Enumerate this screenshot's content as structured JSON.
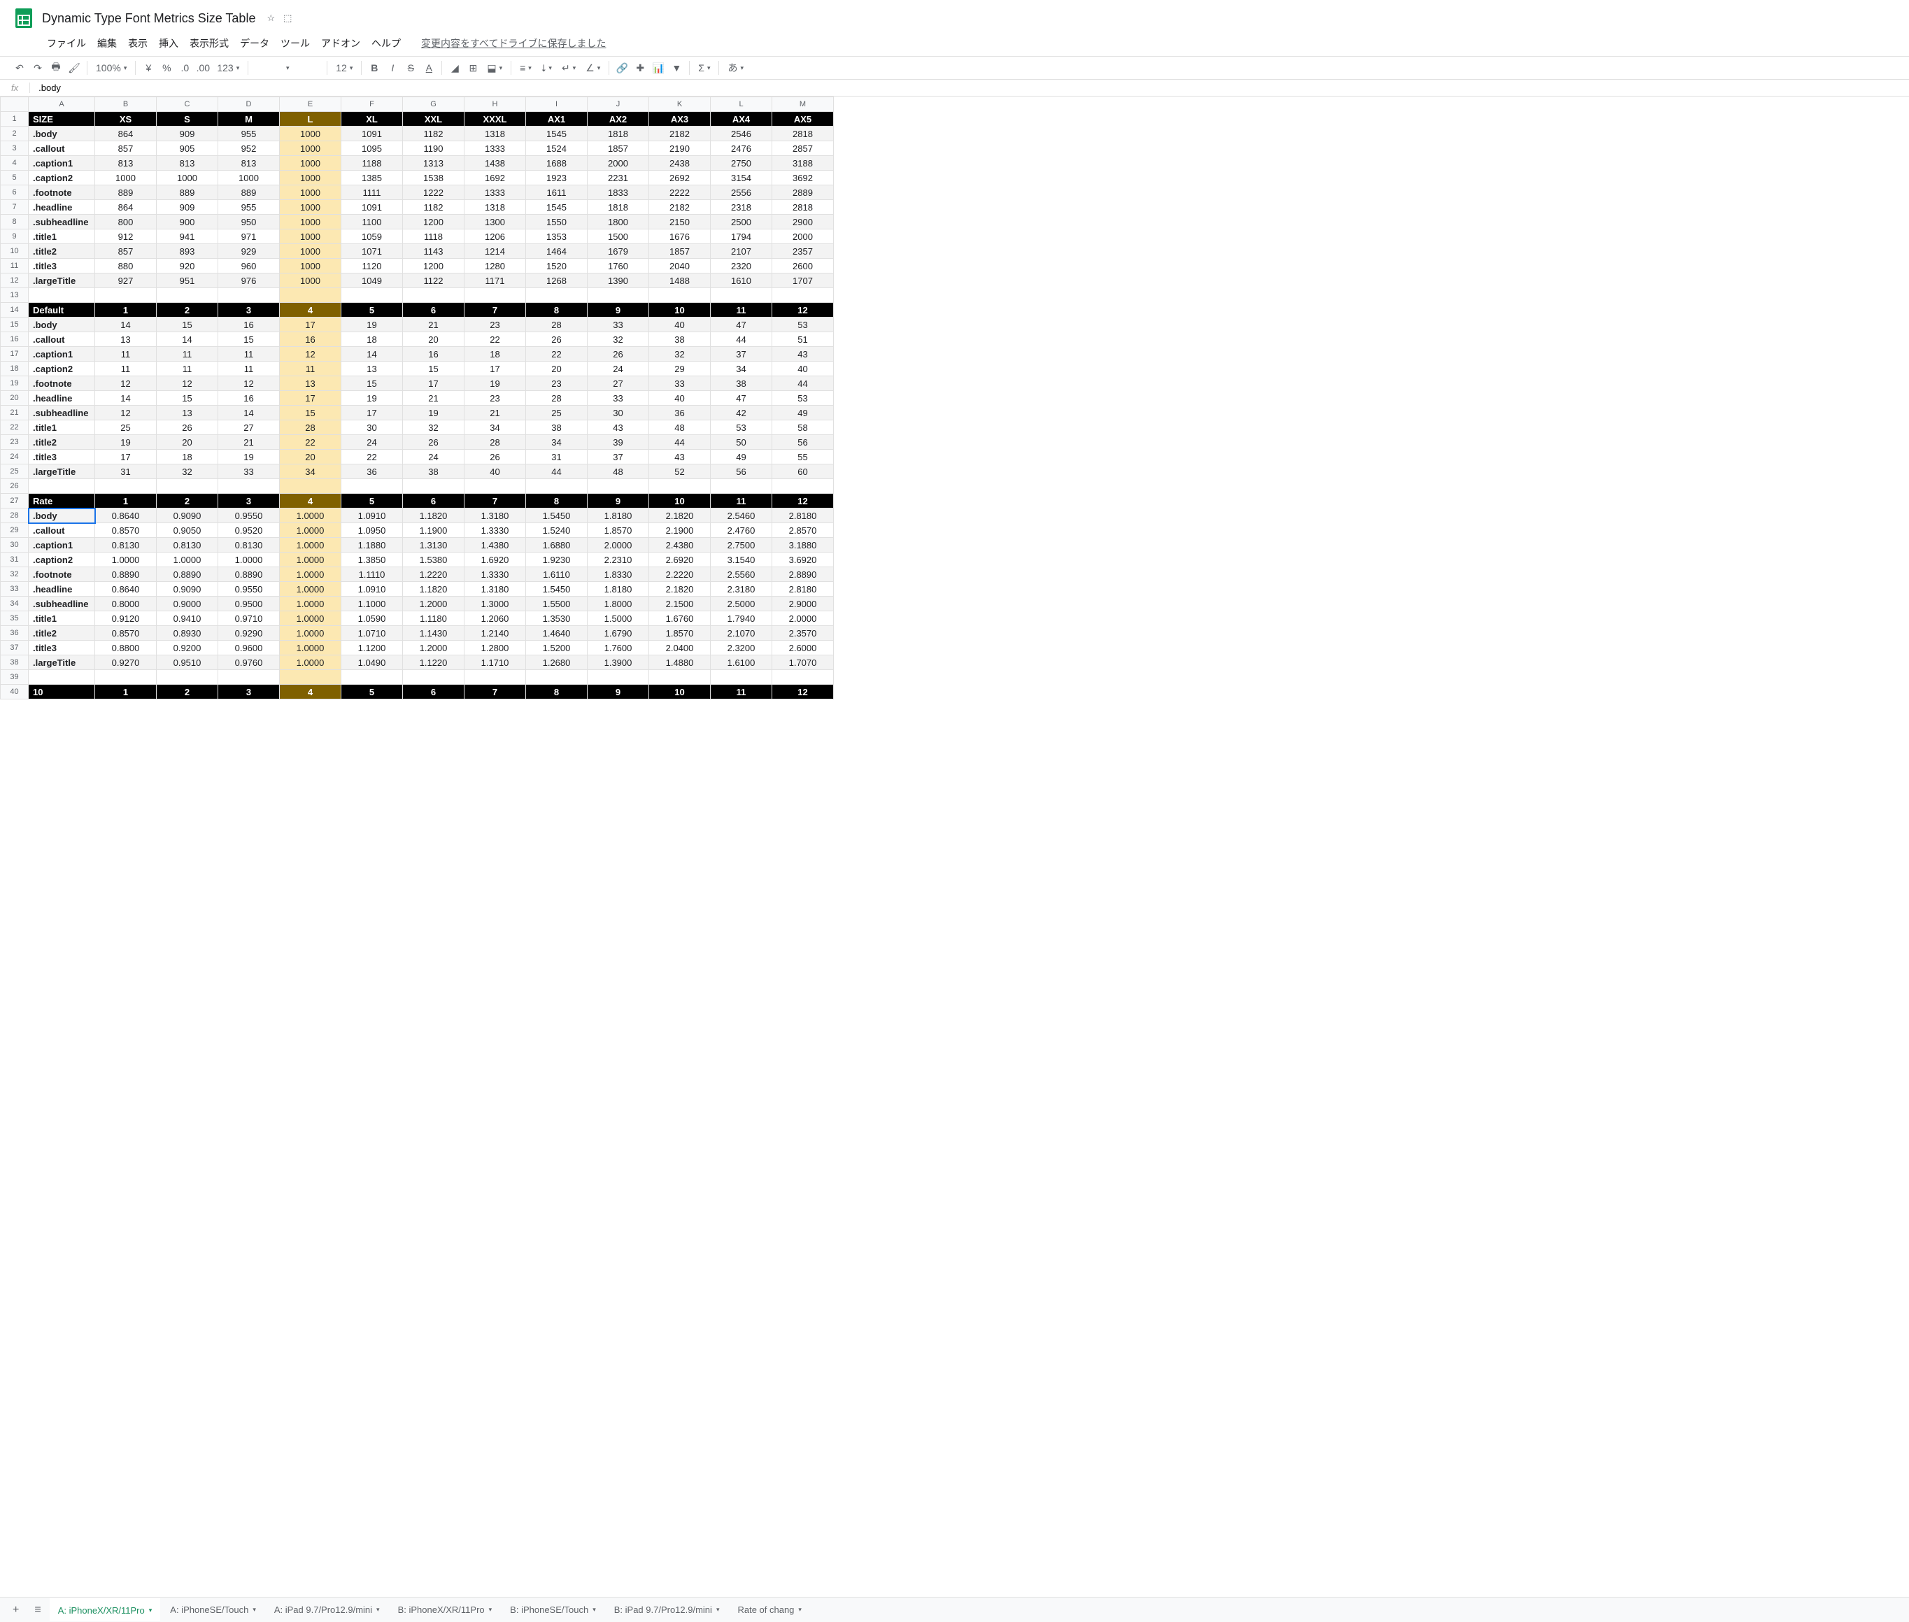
{
  "doc_title": "Dynamic Type Font Metrics Size Table",
  "save_status": "変更内容をすべてドライブに保存しました",
  "menu": [
    "ファイル",
    "編集",
    "表示",
    "挿入",
    "表示形式",
    "データ",
    "ツール",
    "アドオン",
    "ヘルプ"
  ],
  "toolbar": {
    "zoom": "100%",
    "currency": "¥",
    "percent": "%",
    "dec_dec": ".0",
    "inc_dec": ".00",
    "more_formats": "123",
    "font": "",
    "font_size": "12"
  },
  "fx_label": "fx",
  "fx_value": ".body",
  "columns": [
    "A",
    "B",
    "C",
    "D",
    "E",
    "F",
    "G",
    "H",
    "I",
    "J",
    "K",
    "L",
    "M"
  ],
  "size_headers": [
    "SIZE",
    "XS",
    "S",
    "M",
    "L",
    "XL",
    "XXL",
    "XXXL",
    "AX1",
    "AX2",
    "AX3",
    "AX4",
    "AX5"
  ],
  "num_headers_default": [
    "Default",
    "1",
    "2",
    "3",
    "4",
    "5",
    "6",
    "7",
    "8",
    "9",
    "10",
    "11",
    "12"
  ],
  "num_headers_rate": [
    "Rate",
    "1",
    "2",
    "3",
    "4",
    "5",
    "6",
    "7",
    "8",
    "9",
    "10",
    "11",
    "12"
  ],
  "num_headers_10": [
    "10",
    "1",
    "2",
    "3",
    "4",
    "5",
    "6",
    "7",
    "8",
    "9",
    "10",
    "11",
    "12"
  ],
  "size_rows": [
    [
      ".body",
      "864",
      "909",
      "955",
      "1000",
      "1091",
      "1182",
      "1318",
      "1545",
      "1818",
      "2182",
      "2546",
      "2818"
    ],
    [
      ".callout",
      "857",
      "905",
      "952",
      "1000",
      "1095",
      "1190",
      "1333",
      "1524",
      "1857",
      "2190",
      "2476",
      "2857"
    ],
    [
      ".caption1",
      "813",
      "813",
      "813",
      "1000",
      "1188",
      "1313",
      "1438",
      "1688",
      "2000",
      "2438",
      "2750",
      "3188"
    ],
    [
      ".caption2",
      "1000",
      "1000",
      "1000",
      "1000",
      "1385",
      "1538",
      "1692",
      "1923",
      "2231",
      "2692",
      "3154",
      "3692"
    ],
    [
      ".footnote",
      "889",
      "889",
      "889",
      "1000",
      "1111",
      "1222",
      "1333",
      "1611",
      "1833",
      "2222",
      "2556",
      "2889"
    ],
    [
      ".headline",
      "864",
      "909",
      "955",
      "1000",
      "1091",
      "1182",
      "1318",
      "1545",
      "1818",
      "2182",
      "2318",
      "2818"
    ],
    [
      ".subheadline",
      "800",
      "900",
      "950",
      "1000",
      "1100",
      "1200",
      "1300",
      "1550",
      "1800",
      "2150",
      "2500",
      "2900"
    ],
    [
      ".title1",
      "912",
      "941",
      "971",
      "1000",
      "1059",
      "1118",
      "1206",
      "1353",
      "1500",
      "1676",
      "1794",
      "2000"
    ],
    [
      ".title2",
      "857",
      "893",
      "929",
      "1000",
      "1071",
      "1143",
      "1214",
      "1464",
      "1679",
      "1857",
      "2107",
      "2357"
    ],
    [
      ".title3",
      "880",
      "920",
      "960",
      "1000",
      "1120",
      "1200",
      "1280",
      "1520",
      "1760",
      "2040",
      "2320",
      "2600"
    ],
    [
      ".largeTitle",
      "927",
      "951",
      "976",
      "1000",
      "1049",
      "1122",
      "1171",
      "1268",
      "1390",
      "1488",
      "1610",
      "1707"
    ]
  ],
  "default_rows": [
    [
      ".body",
      "14",
      "15",
      "16",
      "17",
      "19",
      "21",
      "23",
      "28",
      "33",
      "40",
      "47",
      "53"
    ],
    [
      ".callout",
      "13",
      "14",
      "15",
      "16",
      "18",
      "20",
      "22",
      "26",
      "32",
      "38",
      "44",
      "51"
    ],
    [
      ".caption1",
      "11",
      "11",
      "11",
      "12",
      "14",
      "16",
      "18",
      "22",
      "26",
      "32",
      "37",
      "43"
    ],
    [
      ".caption2",
      "11",
      "11",
      "11",
      "11",
      "13",
      "15",
      "17",
      "20",
      "24",
      "29",
      "34",
      "40"
    ],
    [
      ".footnote",
      "12",
      "12",
      "12",
      "13",
      "15",
      "17",
      "19",
      "23",
      "27",
      "33",
      "38",
      "44"
    ],
    [
      ".headline",
      "14",
      "15",
      "16",
      "17",
      "19",
      "21",
      "23",
      "28",
      "33",
      "40",
      "47",
      "53"
    ],
    [
      ".subheadline",
      "12",
      "13",
      "14",
      "15",
      "17",
      "19",
      "21",
      "25",
      "30",
      "36",
      "42",
      "49"
    ],
    [
      ".title1",
      "25",
      "26",
      "27",
      "28",
      "30",
      "32",
      "34",
      "38",
      "43",
      "48",
      "53",
      "58"
    ],
    [
      ".title2",
      "19",
      "20",
      "21",
      "22",
      "24",
      "26",
      "28",
      "34",
      "39",
      "44",
      "50",
      "56"
    ],
    [
      ".title3",
      "17",
      "18",
      "19",
      "20",
      "22",
      "24",
      "26",
      "31",
      "37",
      "43",
      "49",
      "55"
    ],
    [
      ".largeTitle",
      "31",
      "32",
      "33",
      "34",
      "36",
      "38",
      "40",
      "44",
      "48",
      "52",
      "56",
      "60"
    ]
  ],
  "rate_rows": [
    [
      ".body",
      "0.8640",
      "0.9090",
      "0.9550",
      "1.0000",
      "1.0910",
      "1.1820",
      "1.3180",
      "1.5450",
      "1.8180",
      "2.1820",
      "2.5460",
      "2.8180"
    ],
    [
      ".callout",
      "0.8570",
      "0.9050",
      "0.9520",
      "1.0000",
      "1.0950",
      "1.1900",
      "1.3330",
      "1.5240",
      "1.8570",
      "2.1900",
      "2.4760",
      "2.8570"
    ],
    [
      ".caption1",
      "0.8130",
      "0.8130",
      "0.8130",
      "1.0000",
      "1.1880",
      "1.3130",
      "1.4380",
      "1.6880",
      "2.0000",
      "2.4380",
      "2.7500",
      "3.1880"
    ],
    [
      ".caption2",
      "1.0000",
      "1.0000",
      "1.0000",
      "1.0000",
      "1.3850",
      "1.5380",
      "1.6920",
      "1.9230",
      "2.2310",
      "2.6920",
      "3.1540",
      "3.6920"
    ],
    [
      ".footnote",
      "0.8890",
      "0.8890",
      "0.8890",
      "1.0000",
      "1.1110",
      "1.2220",
      "1.3330",
      "1.6110",
      "1.8330",
      "2.2220",
      "2.5560",
      "2.8890"
    ],
    [
      ".headline",
      "0.8640",
      "0.9090",
      "0.9550",
      "1.0000",
      "1.0910",
      "1.1820",
      "1.3180",
      "1.5450",
      "1.8180",
      "2.1820",
      "2.3180",
      "2.8180"
    ],
    [
      ".subheadline",
      "0.8000",
      "0.9000",
      "0.9500",
      "1.0000",
      "1.1000",
      "1.2000",
      "1.3000",
      "1.5500",
      "1.8000",
      "2.1500",
      "2.5000",
      "2.9000"
    ],
    [
      ".title1",
      "0.9120",
      "0.9410",
      "0.9710",
      "1.0000",
      "1.0590",
      "1.1180",
      "1.2060",
      "1.3530",
      "1.5000",
      "1.6760",
      "1.7940",
      "2.0000"
    ],
    [
      ".title2",
      "0.8570",
      "0.8930",
      "0.9290",
      "1.0000",
      "1.0710",
      "1.1430",
      "1.2140",
      "1.4640",
      "1.6790",
      "1.8570",
      "2.1070",
      "2.3570"
    ],
    [
      ".title3",
      "0.8800",
      "0.9200",
      "0.9600",
      "1.0000",
      "1.1200",
      "1.2000",
      "1.2800",
      "1.5200",
      "1.7600",
      "2.0400",
      "2.3200",
      "2.6000"
    ],
    [
      ".largeTitle",
      "0.9270",
      "0.9510",
      "0.9760",
      "1.0000",
      "1.0490",
      "1.1220",
      "1.1710",
      "1.2680",
      "1.3900",
      "1.4880",
      "1.6100",
      "1.7070"
    ]
  ],
  "tabs": [
    "A: iPhoneX/XR/11Pro",
    "A: iPhoneSE/Touch",
    "A: iPad 9.7/Pro12.9/mini",
    "B: iPhoneX/XR/11Pro",
    "B: iPhoneSE/Touch",
    "B: iPad 9.7/Pro12.9/mini",
    "Rate of chang"
  ],
  "active_tab": 0,
  "selected_cell": "A28",
  "chart_data": {
    "type": "table",
    "title": "Dynamic Type Font Metrics Size Table",
    "sections": [
      {
        "name": "SIZE",
        "columns": [
          "XS",
          "S",
          "M",
          "L",
          "XL",
          "XXL",
          "XXXL",
          "AX1",
          "AX2",
          "AX3",
          "AX4",
          "AX5"
        ],
        "row_labels": [
          ".body",
          ".callout",
          ".caption1",
          ".caption2",
          ".footnote",
          ".headline",
          ".subheadline",
          ".title1",
          ".title2",
          ".title3",
          ".largeTitle"
        ],
        "values": [
          [
            864,
            909,
            955,
            1000,
            1091,
            1182,
            1318,
            1545,
            1818,
            2182,
            2546,
            2818
          ],
          [
            857,
            905,
            952,
            1000,
            1095,
            1190,
            1333,
            1524,
            1857,
            2190,
            2476,
            2857
          ],
          [
            813,
            813,
            813,
            1000,
            1188,
            1313,
            1438,
            1688,
            2000,
            2438,
            2750,
            3188
          ],
          [
            1000,
            1000,
            1000,
            1000,
            1385,
            1538,
            1692,
            1923,
            2231,
            2692,
            3154,
            3692
          ],
          [
            889,
            889,
            889,
            1000,
            1111,
            1222,
            1333,
            1611,
            1833,
            2222,
            2556,
            2889
          ],
          [
            864,
            909,
            955,
            1000,
            1091,
            1182,
            1318,
            1545,
            1818,
            2182,
            2318,
            2818
          ],
          [
            800,
            900,
            950,
            1000,
            1100,
            1200,
            1300,
            1550,
            1800,
            2150,
            2500,
            2900
          ],
          [
            912,
            941,
            971,
            1000,
            1059,
            1118,
            1206,
            1353,
            1500,
            1676,
            1794,
            2000
          ],
          [
            857,
            893,
            929,
            1000,
            1071,
            1143,
            1214,
            1464,
            1679,
            1857,
            2107,
            2357
          ],
          [
            880,
            920,
            960,
            1000,
            1120,
            1200,
            1280,
            1520,
            1760,
            2040,
            2320,
            2600
          ],
          [
            927,
            951,
            976,
            1000,
            1049,
            1122,
            1171,
            1268,
            1390,
            1488,
            1610,
            1707
          ]
        ]
      },
      {
        "name": "Default",
        "columns": [
          1,
          2,
          3,
          4,
          5,
          6,
          7,
          8,
          9,
          10,
          11,
          12
        ],
        "row_labels": [
          ".body",
          ".callout",
          ".caption1",
          ".caption2",
          ".footnote",
          ".headline",
          ".subheadline",
          ".title1",
          ".title2",
          ".title3",
          ".largeTitle"
        ],
        "values": [
          [
            14,
            15,
            16,
            17,
            19,
            21,
            23,
            28,
            33,
            40,
            47,
            53
          ],
          [
            13,
            14,
            15,
            16,
            18,
            20,
            22,
            26,
            32,
            38,
            44,
            51
          ],
          [
            11,
            11,
            11,
            12,
            14,
            16,
            18,
            22,
            26,
            32,
            37,
            43
          ],
          [
            11,
            11,
            11,
            11,
            13,
            15,
            17,
            20,
            24,
            29,
            34,
            40
          ],
          [
            12,
            12,
            12,
            13,
            15,
            17,
            19,
            23,
            27,
            33,
            38,
            44
          ],
          [
            14,
            15,
            16,
            17,
            19,
            21,
            23,
            28,
            33,
            40,
            47,
            53
          ],
          [
            12,
            13,
            14,
            15,
            17,
            19,
            21,
            25,
            30,
            36,
            42,
            49
          ],
          [
            25,
            26,
            27,
            28,
            30,
            32,
            34,
            38,
            43,
            48,
            53,
            58
          ],
          [
            19,
            20,
            21,
            22,
            24,
            26,
            28,
            34,
            39,
            44,
            50,
            56
          ],
          [
            17,
            18,
            19,
            20,
            22,
            24,
            26,
            31,
            37,
            43,
            49,
            55
          ],
          [
            31,
            32,
            33,
            34,
            36,
            38,
            40,
            44,
            48,
            52,
            56,
            60
          ]
        ]
      },
      {
        "name": "Rate",
        "columns": [
          1,
          2,
          3,
          4,
          5,
          6,
          7,
          8,
          9,
          10,
          11,
          12
        ],
        "row_labels": [
          ".body",
          ".callout",
          ".caption1",
          ".caption2",
          ".footnote",
          ".headline",
          ".subheadline",
          ".title1",
          ".title2",
          ".title3",
          ".largeTitle"
        ],
        "values": [
          [
            0.864,
            0.909,
            0.955,
            1.0,
            1.091,
            1.182,
            1.318,
            1.545,
            1.818,
            2.182,
            2.546,
            2.818
          ],
          [
            0.857,
            0.905,
            0.952,
            1.0,
            1.095,
            1.19,
            1.333,
            1.524,
            1.857,
            2.19,
            2.476,
            2.857
          ],
          [
            0.813,
            0.813,
            0.813,
            1.0,
            1.188,
            1.313,
            1.438,
            1.688,
            2.0,
            2.438,
            2.75,
            3.188
          ],
          [
            1.0,
            1.0,
            1.0,
            1.0,
            1.385,
            1.538,
            1.692,
            1.923,
            2.231,
            2.692,
            3.154,
            3.692
          ],
          [
            0.889,
            0.889,
            0.889,
            1.0,
            1.111,
            1.222,
            1.333,
            1.611,
            1.833,
            2.222,
            2.556,
            2.889
          ],
          [
            0.864,
            0.909,
            0.955,
            1.0,
            1.091,
            1.182,
            1.318,
            1.545,
            1.818,
            2.182,
            2.318,
            2.818
          ],
          [
            0.8,
            0.9,
            0.95,
            1.0,
            1.1,
            1.2,
            1.3,
            1.55,
            1.8,
            2.15,
            2.5,
            2.9
          ],
          [
            0.912,
            0.941,
            0.971,
            1.0,
            1.059,
            1.118,
            1.206,
            1.353,
            1.5,
            1.676,
            1.794,
            2.0
          ],
          [
            0.857,
            0.893,
            0.929,
            1.0,
            1.071,
            1.143,
            1.214,
            1.464,
            1.679,
            1.857,
            2.107,
            2.357
          ],
          [
            0.88,
            0.92,
            0.96,
            1.0,
            1.12,
            1.2,
            1.28,
            1.52,
            1.76,
            2.04,
            2.32,
            2.6
          ],
          [
            0.927,
            0.951,
            0.976,
            1.0,
            1.049,
            1.122,
            1.171,
            1.268,
            1.39,
            1.488,
            1.61,
            1.707
          ]
        ]
      }
    ]
  }
}
